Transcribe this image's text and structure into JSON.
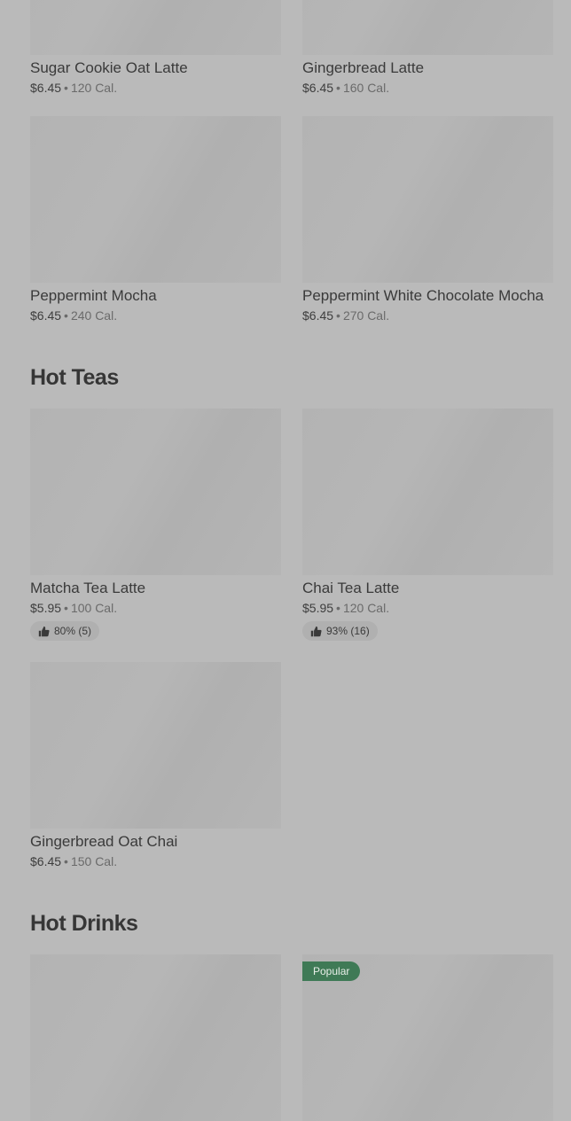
{
  "sections": {
    "hot_teas_title": "Hot Teas",
    "hot_drinks_title": "Hot Drinks"
  },
  "items": [
    {
      "name": "Sugar Cookie Oat Latte",
      "price": "$6.45",
      "cal": "120 Cal."
    },
    {
      "name": "Gingerbread Latte",
      "price": "$6.45",
      "cal": "160 Cal."
    },
    {
      "name": "Peppermint Mocha",
      "price": "$6.45",
      "cal": "240 Cal."
    },
    {
      "name": "Peppermint White Chocolate Mocha",
      "price": "$6.45",
      "cal": "270 Cal."
    },
    {
      "name": "Matcha Tea Latte",
      "price": "$5.95",
      "cal": "100 Cal.",
      "rating": "80% (5)"
    },
    {
      "name": "Chai Tea Latte",
      "price": "$5.95",
      "cal": "120 Cal.",
      "rating": "93% (16)"
    },
    {
      "name": "Gingerbread Oat Chai",
      "price": "$6.45",
      "cal": "150 Cal."
    }
  ],
  "badges": {
    "popular": "Popular"
  },
  "separator": "•",
  "icons": {
    "rating": "thumbs-up-icon"
  }
}
